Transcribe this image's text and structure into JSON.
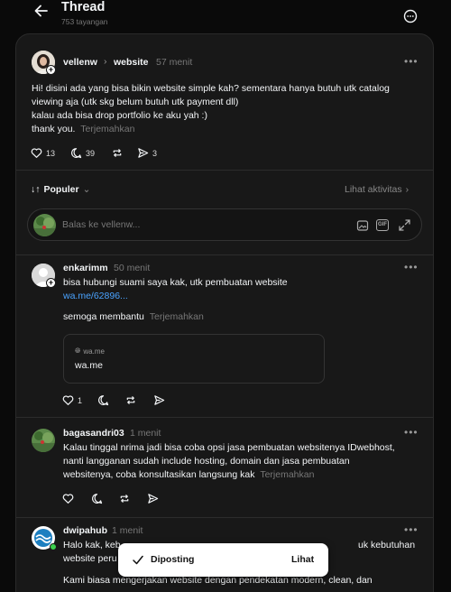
{
  "header": {
    "title": "Thread",
    "views": "753 tayangan"
  },
  "post": {
    "username": "vellenw",
    "breadcrumb_sep": "›",
    "topic": "website",
    "time": "57 menit",
    "lines": [
      "Hi! disini ada yang bisa bikin website simple kah? sementara hanya butuh utk catalog",
      "viewing aja (utk skg belum butuh utk payment dll)",
      "kalau ada bisa drop portfolio ke aku yah :)"
    ],
    "last_line": "thank you.",
    "translate": "Terjemahkan",
    "likes": "13",
    "replies": "39",
    "shares": "3"
  },
  "sort": {
    "label": "Populer",
    "activity": "Lihat aktivitas"
  },
  "reply_box": {
    "placeholder": "Balas ke vellenw..."
  },
  "comments": [
    {
      "username": "enkarimm",
      "time": "50 menit",
      "line1": "bisa hubungi suami saya kak, utk pembuatan website",
      "link": "wa.me/62896...",
      "line2": "semoga membantu",
      "translate": "Terjemahkan",
      "preview_domain": "wa.me",
      "preview_title": "wa.me",
      "likes": "1"
    },
    {
      "username": "bagasandri03",
      "time": "1 menit",
      "lines": [
        "Kalau tinggal nrima jadi bisa coba opsi jasa pembuatan websitenya IDwebhost,",
        "nanti langganan sudah include hosting, domain dan jasa pembuatan"
      ],
      "last_line": "websitenya, coba konsultasikan langsung kak",
      "translate": "Terjemahkan"
    },
    {
      "username": "dwipahub",
      "time": "1 menit",
      "line1_start": "Halo kak, keb",
      "line1_end": "uk kebutuhan",
      "line2_start": "website peru",
      "line3": "Kami biasa mengerjakan website dengan pendekatan modern, clean, dan"
    }
  ],
  "toast": {
    "label": "Diposting",
    "action": "Lihat"
  },
  "colors": {
    "background": "#0a0a0a",
    "card": "#181818",
    "link": "#4aa3ff",
    "muted": "#777777"
  }
}
